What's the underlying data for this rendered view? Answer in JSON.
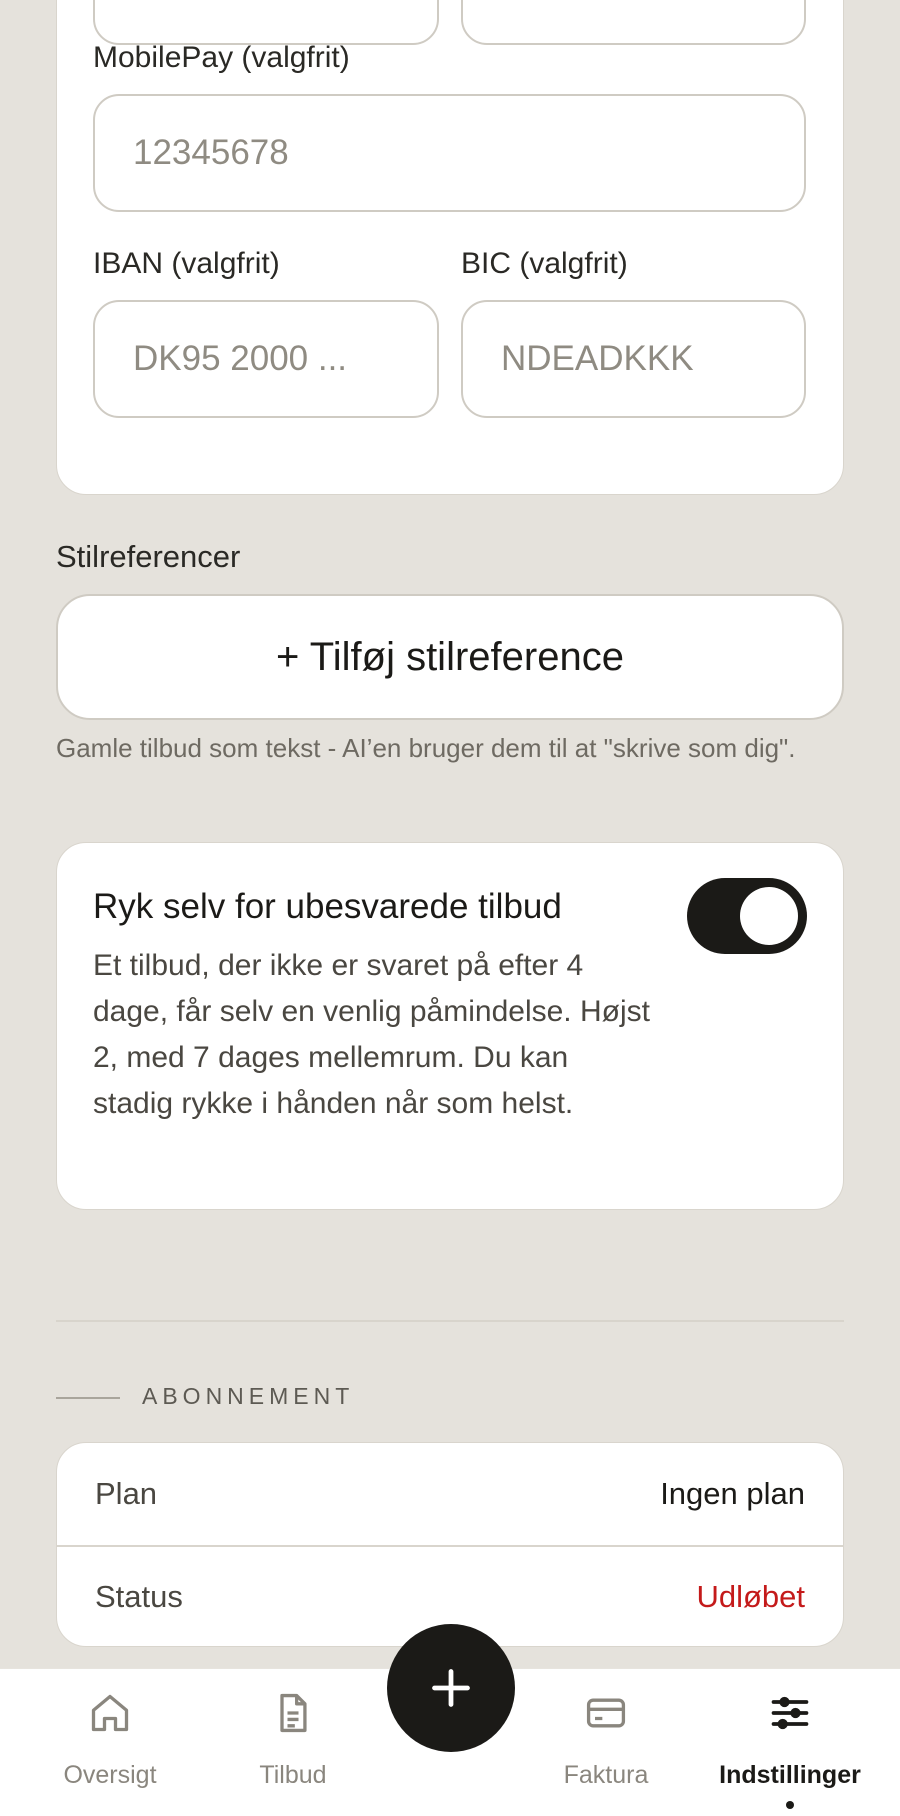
{
  "payment": {
    "mobilepay_label": "MobilePay (valgfrit)",
    "mobilepay_placeholder": "12345678",
    "iban_label": "IBAN (valgfrit)",
    "iban_placeholder": "DK95 2000 ...",
    "bic_label": "BIC (valgfrit)",
    "bic_placeholder": "NDEADKKK"
  },
  "style_refs": {
    "title": "Stilreferencer",
    "add_label": "+ Tilføj stilreference",
    "hint": "Gamle tilbud som tekst - AI’en bruger dem til at \"skrive som dig\"."
  },
  "reminder": {
    "title": "Ryk selv for ubesvarede tilbud",
    "description": "Et tilbud, der ikke er svaret på efter 4 dage, får selv en venlig påmindelse. Højst 2, med 7 dages mellemrum. Du kan stadig rykke i hånden når som helst.",
    "enabled": true
  },
  "subscription": {
    "section_title": "ABONNEMENT",
    "plan_label": "Plan",
    "plan_value": "Ingen plan",
    "status_label": "Status",
    "status_value": "Udløbet",
    "status_color": "#c41a1a"
  },
  "nav": {
    "items": [
      {
        "label": "Oversigt",
        "icon": "home-icon"
      },
      {
        "label": "Tilbud",
        "icon": "document-icon"
      },
      {
        "label": "Faktura",
        "icon": "card-icon"
      },
      {
        "label": "Indstillinger",
        "icon": "sliders-icon",
        "active": true
      }
    ],
    "fab_icon": "plus-icon"
  }
}
